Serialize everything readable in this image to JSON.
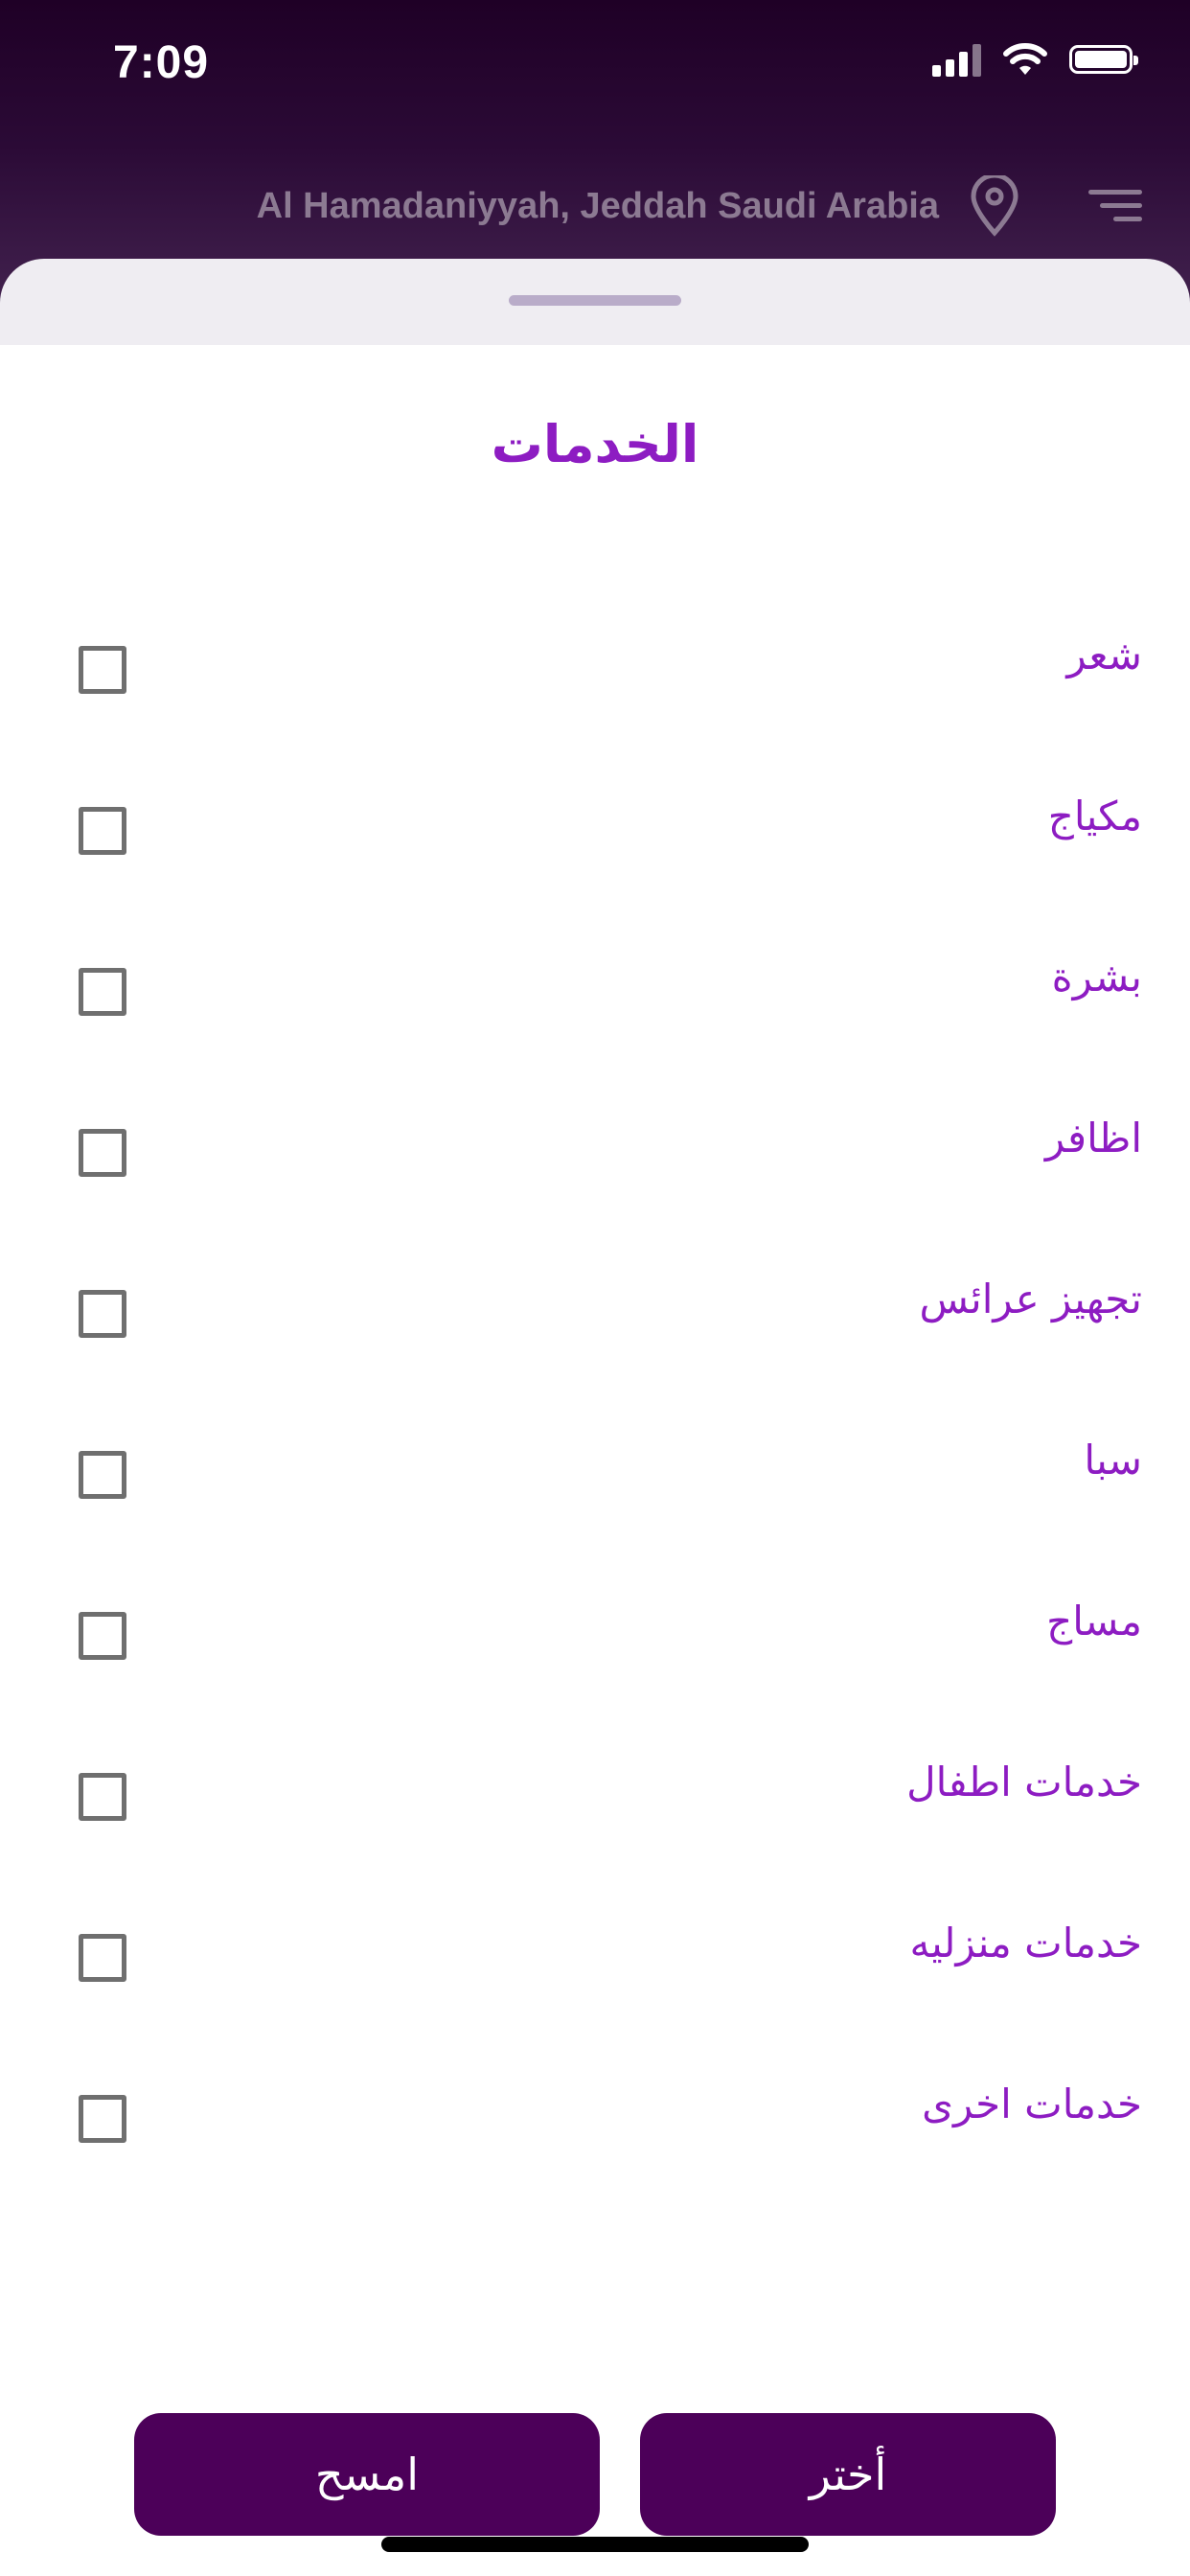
{
  "status_bar": {
    "time": "7:09"
  },
  "header": {
    "location": "Al Hamadaniyyah, Jeddah Saudi Arabia"
  },
  "sheet": {
    "title": "الخدمات",
    "options": [
      {
        "label": "شعر",
        "checked": false
      },
      {
        "label": "مكياج",
        "checked": false
      },
      {
        "label": "بشرة",
        "checked": false
      },
      {
        "label": "اظافر",
        "checked": false
      },
      {
        "label": "تجهيز عرائس",
        "checked": false
      },
      {
        "label": "سبا",
        "checked": false
      },
      {
        "label": "مساج",
        "checked": false
      },
      {
        "label": "خدمات اطفال",
        "checked": false
      },
      {
        "label": "خدمات منزليه",
        "checked": false
      },
      {
        "label": "خدمات اخرى",
        "checked": false
      }
    ],
    "clear_label": "امسح",
    "select_label": "أختر"
  },
  "colors": {
    "accent": "#8d1cc2",
    "button": "#4c0059",
    "header_bg": "#2b0a36"
  }
}
